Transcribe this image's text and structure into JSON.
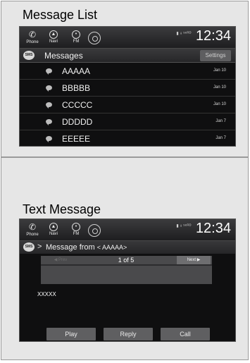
{
  "top_section": {
    "title": "Message List"
  },
  "bottom_section": {
    "title": "Text Message"
  },
  "statusbar": {
    "phone_label": "Phone",
    "navi_label": "Navi",
    "fm_label": "FM",
    "status_text": "▮ ᵻ ˢᵉᴿᴰ",
    "clock": "12:34"
  },
  "message_list": {
    "badge": "SMS",
    "title": "Messages",
    "settings_label": "Settings",
    "items": [
      {
        "name": "AAAAA",
        "date": "Jan 10"
      },
      {
        "name": "BBBBB",
        "date": "Jan 10"
      },
      {
        "name": "CCCCC",
        "date": "Jan 10"
      },
      {
        "name": "DDDDD",
        "date": "Jan 7"
      },
      {
        "name": "EEEEE",
        "date": "Jan 7"
      }
    ]
  },
  "text_message": {
    "badge": "SMS",
    "header_prefix": "Message from ",
    "sender": "< AAAAA>",
    "prev_label": "◀ Prev",
    "current": "1",
    "of_text": " of ",
    "total": "5",
    "next_label": "Next ▶",
    "body": "XXXXX",
    "play_label": "Play",
    "reply_label": "Reply",
    "call_label": "Call"
  },
  "colors": {
    "screen_bg": "#0f0f10",
    "panel_bg": "#e6e6e6",
    "button_bg": "#5f5f61"
  },
  "icons": {
    "phone": "phone-icon",
    "navi": "navi-icon",
    "fm": "fm-icon",
    "audio": "audio-icon",
    "message": "message-bubble-icon",
    "arrow": "down-arrow-icon"
  }
}
